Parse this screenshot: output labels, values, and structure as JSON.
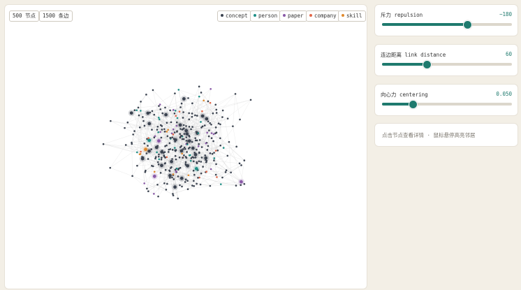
{
  "stats": {
    "nodes": "500 节点",
    "edges": "1500 条边"
  },
  "legend": [
    {
      "label": "concept",
      "color": "#3b4350"
    },
    {
      "label": "person",
      "color": "#1f8f86"
    },
    {
      "label": "paper",
      "color": "#8a5aa8"
    },
    {
      "label": "company",
      "color": "#e2674a"
    },
    {
      "label": "skill",
      "color": "#e08a2e"
    }
  ],
  "controls": {
    "repulsion": {
      "label": "斥力 repulsion",
      "value": "−180",
      "level": 0.65
    },
    "link_distance": {
      "label": "连边距离 link distance",
      "value": "60",
      "level": 0.34
    },
    "centering": {
      "label": "向心力 centering",
      "value": "0.050",
      "level": 0.23
    }
  },
  "info": {
    "hint": "点击节点查看详情 · 鼠标悬停高亮邻居"
  },
  "colors": {
    "accent": "#1f7a6e",
    "background": "#f3efe6",
    "edge": "#cfcfcf"
  }
}
